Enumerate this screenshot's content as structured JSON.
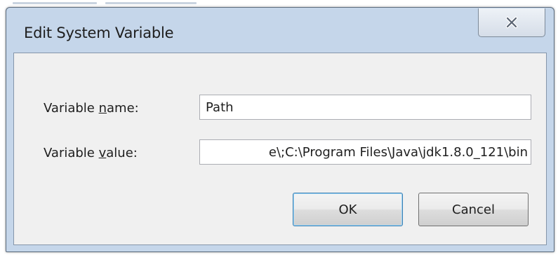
{
  "dialog": {
    "title": "Edit System Variable",
    "close_icon": "close-x-icon"
  },
  "fields": {
    "name": {
      "label_before": "Variable ",
      "label_accel": "n",
      "label_after": "ame:",
      "value": "Path"
    },
    "value": {
      "label_before": "Variable ",
      "label_accel": "v",
      "label_after": "alue:",
      "value": "e\\;C:\\Program Files\\Java\\jdk1.8.0_121\\bin"
    }
  },
  "buttons": {
    "ok_label": "OK",
    "cancel_label": "Cancel"
  },
  "colors": {
    "frame": "#c5d6ea",
    "client": "#f0f0f0",
    "ok_focus_border": "#3c7fb1"
  }
}
